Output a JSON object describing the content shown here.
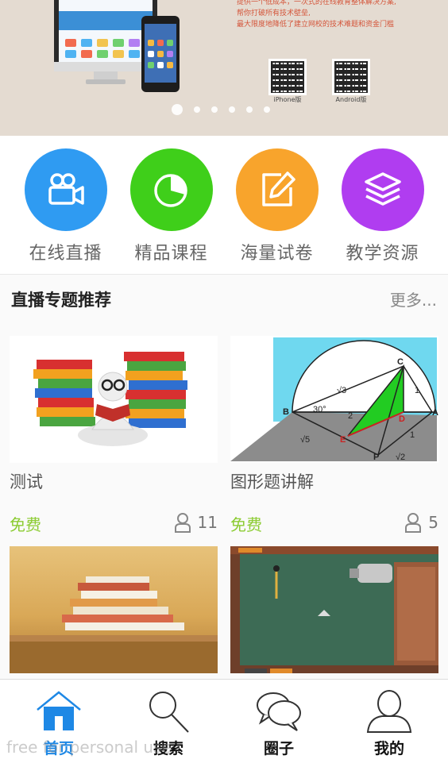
{
  "banner": {
    "lines": [
      "提供一个低成本，一次式的在线教育整体解决方案,",
      "帮你打破所有技术壁垒,",
      "最大限度地降低了建立网校的技术难题和资金门槛"
    ],
    "qr_iphone_label": "iPhone版",
    "qr_android_label": "Android版",
    "slide_count": 6,
    "active_slide": 1
  },
  "quick_nav": [
    {
      "label": "在线直播",
      "color": "#2f9bf2",
      "icon": "video-camera-icon"
    },
    {
      "label": "精品课程",
      "color": "#3fcf1a",
      "icon": "pie-chart-icon"
    },
    {
      "label": "海量试卷",
      "color": "#f8a42c",
      "icon": "edit-icon"
    },
    {
      "label": "教学资源",
      "color": "#b03df0",
      "icon": "layers-icon"
    }
  ],
  "section": {
    "title": "直播专题推荐",
    "more": "更多..."
  },
  "cards": [
    {
      "title": "测试",
      "price": "免费",
      "count": "11",
      "image": "books-reader-image"
    },
    {
      "title": "图形题讲解",
      "price": "免费",
      "count": "5",
      "image": "geometry-diagram-image"
    },
    {
      "title": "",
      "price": "",
      "count": "",
      "image": "book-stack-image"
    },
    {
      "title": "",
      "price": "",
      "count": "",
      "image": "physics-experiment-image"
    }
  ],
  "tabs": [
    {
      "label": "首页",
      "icon": "home-icon",
      "active": true
    },
    {
      "label": "搜索",
      "icon": "search-icon",
      "active": false
    },
    {
      "label": "圈子",
      "icon": "chat-bubbles-icon",
      "active": false
    },
    {
      "label": "我的",
      "icon": "user-icon",
      "active": false
    }
  ],
  "watermark": "free for personal use",
  "colors": {
    "accent": "#1e88e5",
    "price": "#8ccc32"
  }
}
